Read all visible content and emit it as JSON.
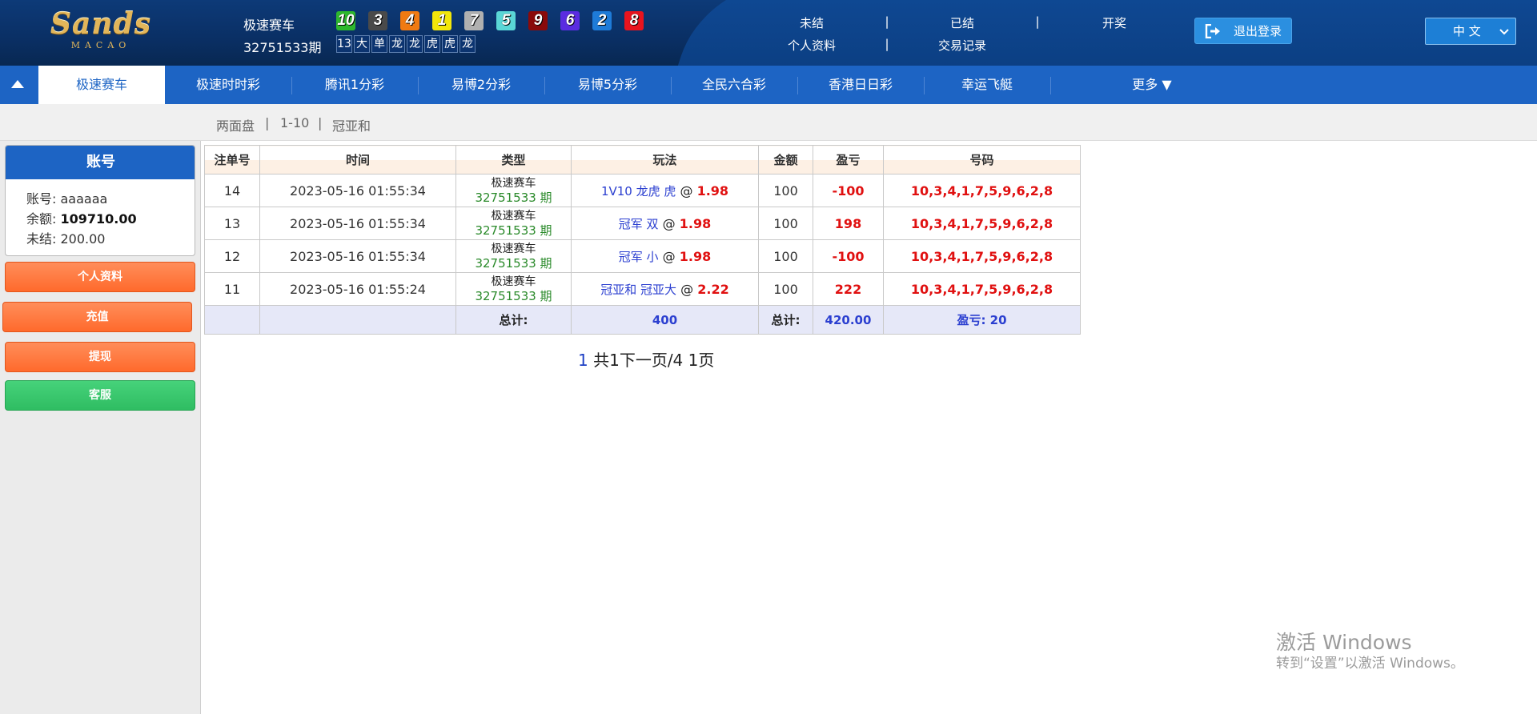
{
  "brand": {
    "logo_main": "Sands",
    "logo_sub": "MACAO"
  },
  "game": {
    "name": "极速赛车",
    "period": "32751533期"
  },
  "balls": [
    {
      "num": "10",
      "color": "#2db82d"
    },
    {
      "num": "3",
      "color": "#4a4a4a"
    },
    {
      "num": "4",
      "color": "#f07a12"
    },
    {
      "num": "1",
      "color": "#f2e60a"
    },
    {
      "num": "7",
      "color": "#b0b0b0"
    },
    {
      "num": "5",
      "color": "#5ad6d6"
    },
    {
      "num": "9",
      "color": "#8a0a0a"
    },
    {
      "num": "6",
      "color": "#5a2ce0"
    },
    {
      "num": "2",
      "color": "#1e7bd8"
    },
    {
      "num": "8",
      "color": "#e8141e"
    }
  ],
  "results": [
    "13",
    "大",
    "单",
    "龙",
    "龙",
    "虎",
    "虎",
    "龙"
  ],
  "topnav": {
    "unsettled": "未结",
    "settled": "已结",
    "draw": "开奖",
    "profile": "个人资料",
    "transactions": "交易记录",
    "sep": "|"
  },
  "logout_label": "退出登录",
  "language": "中 文",
  "tabs": [
    {
      "label": "极速赛车",
      "active": true
    },
    {
      "label": "极速时时彩"
    },
    {
      "label": "腾讯1分彩"
    },
    {
      "label": "易博2分彩"
    },
    {
      "label": "易博5分彩"
    },
    {
      "label": "全民六合彩"
    },
    {
      "label": "香港日日彩"
    },
    {
      "label": "幸运飞艇"
    },
    {
      "label": "更多 ▼"
    }
  ],
  "breadcrumb": {
    "a": "两面盘",
    "b": "1-10",
    "c": "冠亚和",
    "sep": "|"
  },
  "account": {
    "title": "账号",
    "username_label": "账号:",
    "username": "aaaaaa",
    "balance_label": "余额:",
    "balance": "109710.00",
    "unsettled_label": "未结:",
    "unsettled": "200.00"
  },
  "side_buttons": {
    "profile": "个人资料",
    "deposit": "充值",
    "withdraw": "提现",
    "service": "客服"
  },
  "table": {
    "headers": [
      "注单号",
      "时间",
      "类型",
      "玩法",
      "金额",
      "盈亏",
      "号码"
    ],
    "rows": [
      {
        "id": "14",
        "time": "2023-05-16 01:55:34",
        "type": "极速赛车",
        "period": "32751533 期",
        "play": "1V10 龙虎 虎",
        "at": "@",
        "odds": "1.98",
        "amount": "100",
        "pl": "-100",
        "nums": "10,3,4,1,7,5,9,6,2,8"
      },
      {
        "id": "13",
        "time": "2023-05-16 01:55:34",
        "type": "极速赛车",
        "period": "32751533 期",
        "play": "冠军 双",
        "at": "@",
        "odds": "1.98",
        "amount": "100",
        "pl": "198",
        "nums": "10,3,4,1,7,5,9,6,2,8"
      },
      {
        "id": "12",
        "time": "2023-05-16 01:55:34",
        "type": "极速赛车",
        "period": "32751533 期",
        "play": "冠军 小",
        "at": "@",
        "odds": "1.98",
        "amount": "100",
        "pl": "-100",
        "nums": "10,3,4,1,7,5,9,6,2,8"
      },
      {
        "id": "11",
        "time": "2023-05-16 01:55:24",
        "type": "极速赛车",
        "period": "32751533 期",
        "play": "冠亚和 冠亚大",
        "at": "@",
        "odds": "2.22",
        "amount": "100",
        "pl": "222",
        "nums": "10,3,4,1,7,5,9,6,2,8"
      }
    ],
    "total": {
      "label1": "总计:",
      "count": "400",
      "label2": "总计:",
      "amount": "420.00",
      "profit": "盈亏: 20"
    }
  },
  "pager": {
    "current": "1",
    "text": " 共1下一页/4 1页"
  },
  "watermark": {
    "line1": "激活 Windows",
    "line2": "转到“设置”以激活 Windows。"
  }
}
